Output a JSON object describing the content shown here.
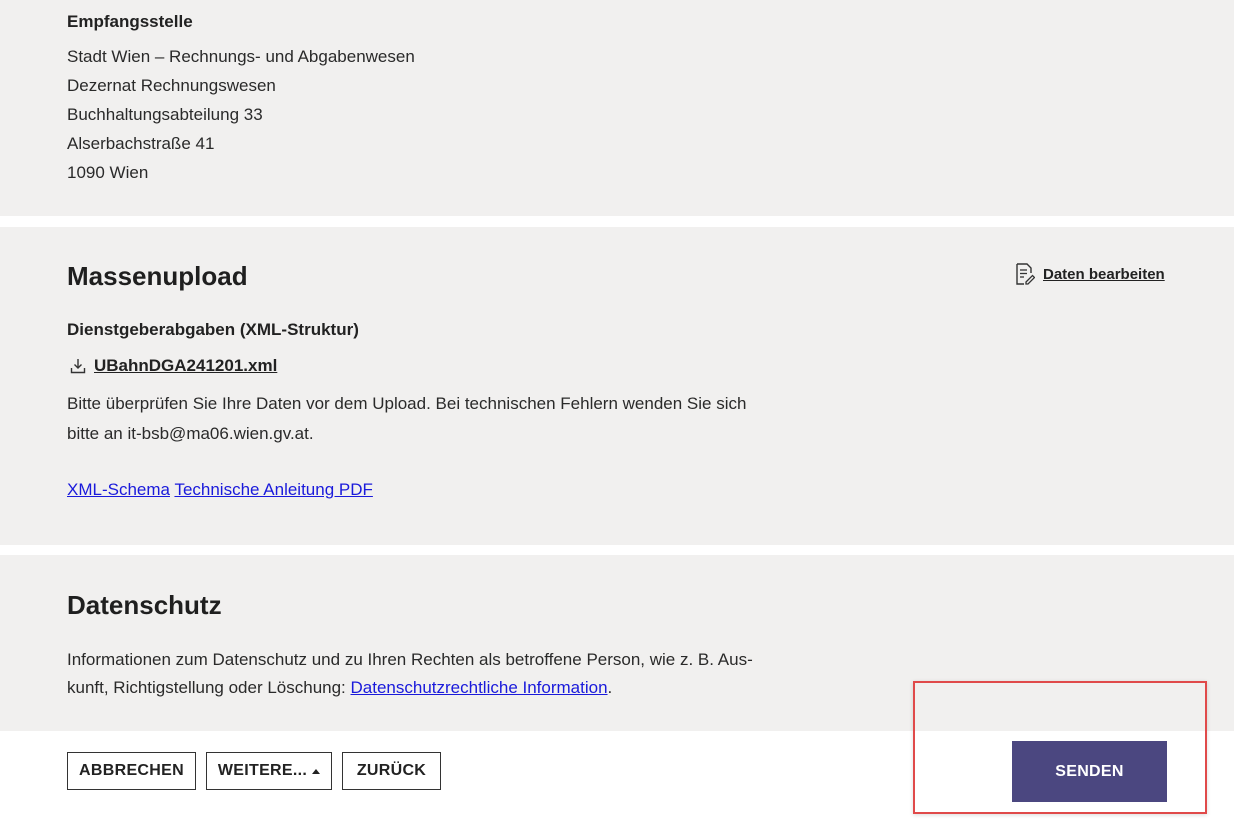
{
  "recipient": {
    "heading": "Empfangsstelle",
    "lines": [
      "Stadt Wien – Rechnungs- und Abgabenwesen",
      "Dezernat Rechnungswesen",
      "Buchhaltungsabteilung 33",
      "Alserbachstraße 41",
      "1090 Wien"
    ]
  },
  "upload": {
    "title": "Massenupload",
    "edit_label": "Daten bearbeiten",
    "edit_icon": "edit-document-icon",
    "section_label": "Dienstgeberabgaben (XML-Struktur)",
    "download_icon": "download-icon",
    "file_name": "UBahnDGA241201.xml",
    "info_line1": "Bitte überprüfen Sie Ihre Daten vor dem Upload. Bei technischen Fehlern wenden Sie sich",
    "info_line2": "bitte an it-bsb@ma06.wien.gv.at.",
    "link_schema": "XML-Schema",
    "link_manual": "Technische Anleitung PDF"
  },
  "privacy": {
    "title": "Datenschutz",
    "text_line1": "Informationen zum Datenschutz und zu Ihren Rechten als betroffene Person, wie z. B. Aus-",
    "text_line2_prefix": "kunft, Richtigstellung oder Löschung: ",
    "link": "Datenschutzrechtliche Information",
    "text_line2_suffix": "."
  },
  "actions": {
    "cancel": "ABBRECHEN",
    "more": "WEITERE...",
    "back": "ZURÜCK",
    "send": "SENDEN"
  },
  "colors": {
    "panel_bg": "#f1f0ef",
    "primary": "#4b4780",
    "highlight": "#e04a4a",
    "link": "#1a1adb"
  }
}
